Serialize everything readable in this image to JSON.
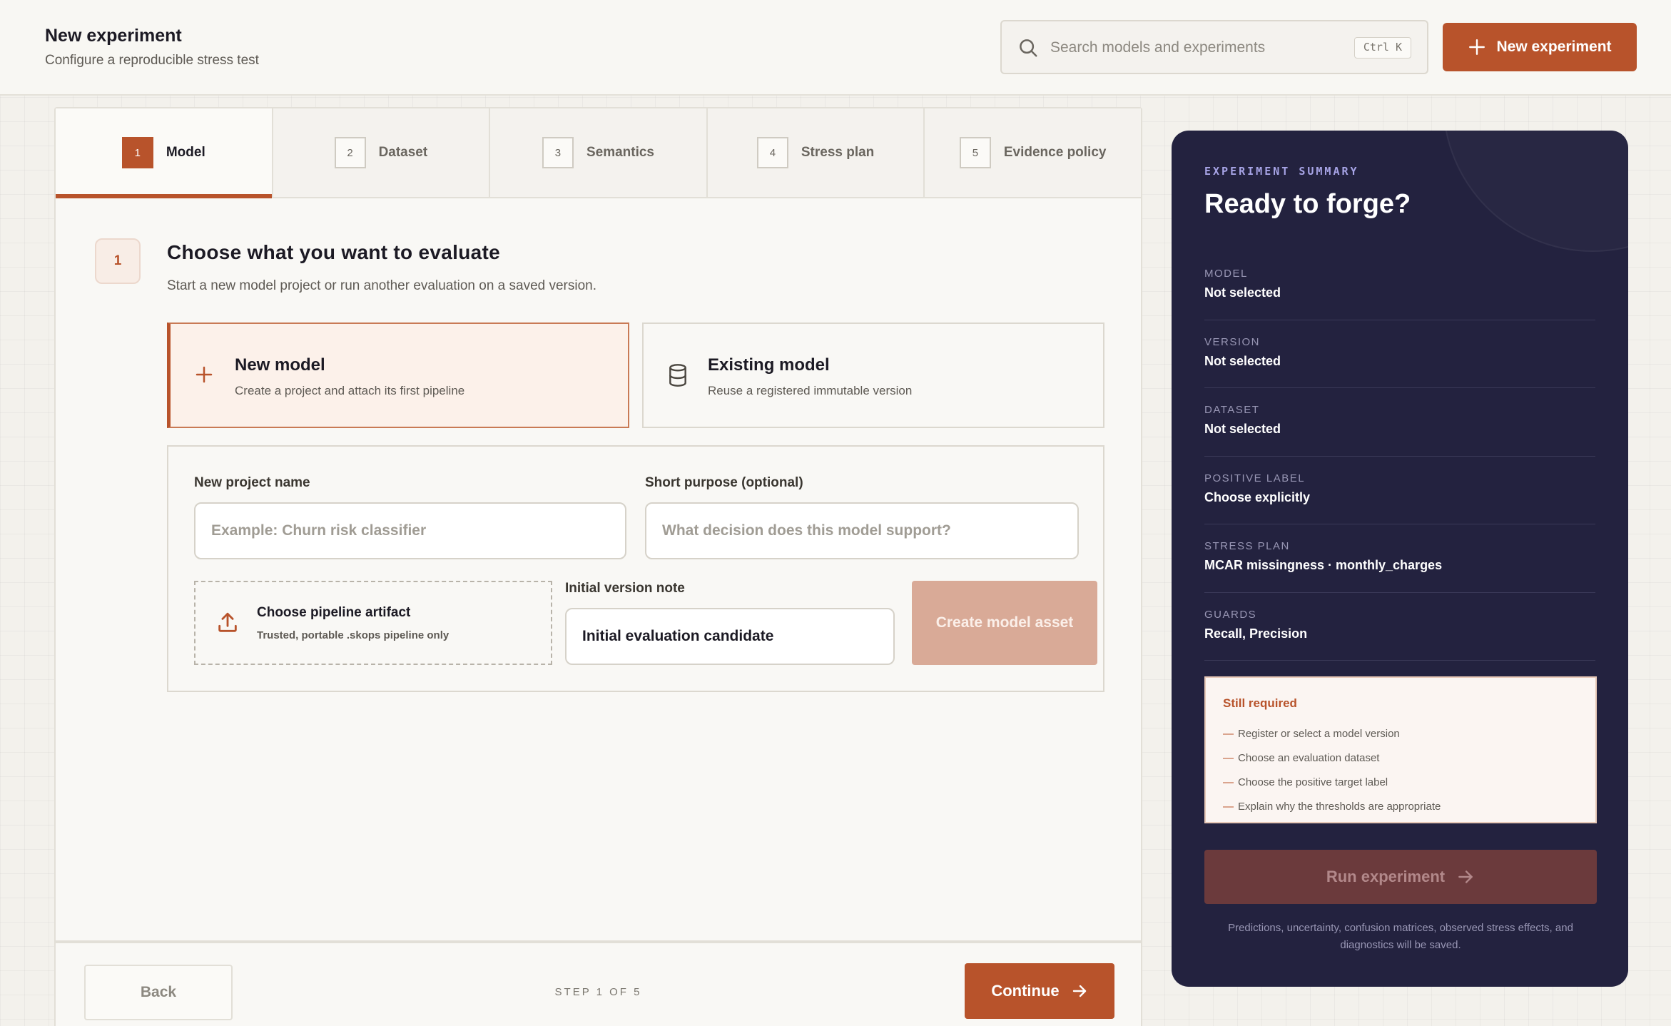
{
  "header": {
    "title": "New experiment",
    "subtitle": "Configure a reproducible stress test",
    "search": {
      "placeholder": "Search models and experiments",
      "shortcut": "Ctrl K",
      "icon": "search-icon"
    },
    "new_button": {
      "label": "New experiment",
      "icon": "plus-icon"
    }
  },
  "tabs": [
    {
      "num": "1",
      "label": "Model",
      "active": true
    },
    {
      "num": "2",
      "label": "Dataset",
      "active": false
    },
    {
      "num": "3",
      "label": "Semantics",
      "active": false
    },
    {
      "num": "4",
      "label": "Stress plan",
      "active": false
    },
    {
      "num": "5",
      "label": "Evidence policy",
      "active": false
    }
  ],
  "section": {
    "step": "1",
    "title": "Choose what you want to evaluate",
    "subtitle": "Start a new model project or run another evaluation on a saved version."
  },
  "choices": {
    "new_model": {
      "title": "New model",
      "desc": "Create a project and attach its first pipeline",
      "icon": "plus-icon",
      "selected": true
    },
    "existing_model": {
      "title": "Existing model",
      "desc": "Reuse a registered immutable version",
      "icon": "database-icon",
      "selected": false
    }
  },
  "form": {
    "project_name": {
      "label": "New project name",
      "placeholder": "Example: Churn risk classifier",
      "value": ""
    },
    "purpose": {
      "label": "Short purpose (optional)",
      "placeholder": "What decision does this model support?",
      "value": ""
    },
    "artifact": {
      "title": "Choose pipeline artifact",
      "subtitle": "Trusted, portable .skops pipeline only",
      "icon": "upload-icon"
    },
    "version_note": {
      "label": "Initial version note",
      "value": "Initial evaluation candidate"
    },
    "create_button": "Create model asset"
  },
  "footer": {
    "back": "Back",
    "step_counter": "STEP 1 OF 5",
    "continue": "Continue"
  },
  "summary": {
    "eyebrow": "EXPERIMENT SUMMARY",
    "title": "Ready to forge?",
    "rows": [
      {
        "key": "MODEL",
        "value": "Not selected"
      },
      {
        "key": "VERSION",
        "value": "Not selected"
      },
      {
        "key": "DATASET",
        "value": "Not selected"
      },
      {
        "key": "POSITIVE LABEL",
        "value": "Choose explicitly"
      },
      {
        "key": "STRESS PLAN",
        "value": "MCAR missingness · monthly_charges"
      },
      {
        "key": "GUARDS",
        "value": "Recall, Precision"
      }
    ],
    "required": {
      "title": "Still required",
      "items": [
        "Register or select a model version",
        "Choose an evaluation dataset",
        "Choose the positive target label",
        "Explain why the thresholds are appropriate"
      ]
    },
    "run_button": "Run experiment",
    "note": "Predictions, uncertainty, confusion matrices, observed stress effects, and diagnostics will be saved."
  },
  "colors": {
    "accent": "#b8532b",
    "accent_disabled": "#d9aa97",
    "panel": "#23223f",
    "run_disabled": "#6b3a3c"
  }
}
